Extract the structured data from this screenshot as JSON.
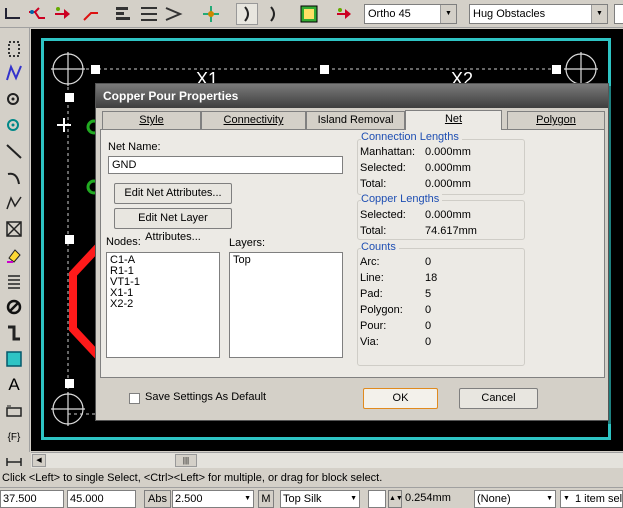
{
  "toolbar": {
    "grid_mode": "Ortho 45",
    "obstacle_mode": "Hug Obstacles"
  },
  "canvas": {
    "labels": [
      "X1",
      "X2"
    ]
  },
  "dialog": {
    "title": "Copper Pour Properties",
    "tabs": [
      "Style",
      "Connectivity",
      "Island Removal",
      "Net",
      "Polygon"
    ],
    "net_name_label": "Net Name:",
    "net_name_value": "GND",
    "edit_net_attr": "Edit Net Attributes...",
    "edit_net_layer_attr": "Edit Net Layer Attributes...",
    "nodes_label": "Nodes:",
    "layers_label": "Layers:",
    "nodes": [
      "C1-A",
      "R1-1",
      "VT1-1",
      "X1-1",
      "X2-2"
    ],
    "layers": [
      "Top"
    ],
    "connection_lengths": {
      "title": "Connection Lengths",
      "rows": [
        {
          "k": "Manhattan:",
          "v": "0.000mm"
        },
        {
          "k": "Selected:",
          "v": "0.000mm"
        },
        {
          "k": "Total:",
          "v": "0.000mm"
        }
      ]
    },
    "copper_lengths": {
      "title": "Copper Lengths",
      "rows": [
        {
          "k": "Selected:",
          "v": "0.000mm"
        },
        {
          "k": "Total:",
          "v": "74.617mm"
        }
      ]
    },
    "counts": {
      "title": "Counts",
      "rows": [
        {
          "k": "Arc:",
          "v": "0"
        },
        {
          "k": "Line:",
          "v": "18"
        },
        {
          "k": "Pad:",
          "v": "5"
        },
        {
          "k": "Polygon:",
          "v": "0"
        },
        {
          "k": "Pour:",
          "v": "0"
        },
        {
          "k": "Via:",
          "v": "0"
        }
      ]
    },
    "save_default": "Save Settings As Default",
    "ok": "OK",
    "cancel": "Cancel"
  },
  "status_message": "Click <Left> to single Select, <Ctrl><Left> for multiple, or drag for block select.",
  "bottom": {
    "x": "37.500",
    "y": "45.000",
    "abs": "Abs",
    "grid": "2.500",
    "m": "M",
    "layer": "Top Silk",
    "width": "0.254mm",
    "net": "(None)",
    "selection": "1 item sel"
  },
  "colors": {
    "board_outline": "#2ec4c4",
    "track": "#ff1a1a",
    "group_title": "#1f4fb3"
  }
}
